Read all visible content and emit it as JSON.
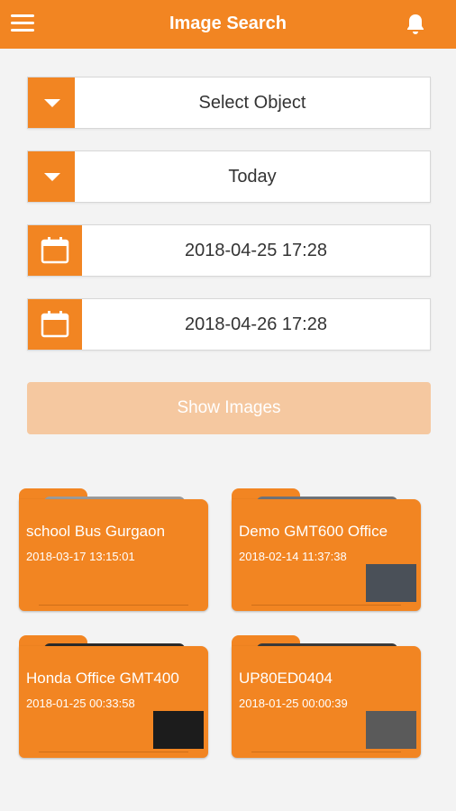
{
  "header": {
    "title": "Image Search",
    "menu_icon": "hamburger-menu-icon",
    "bell_icon": "bell-icon"
  },
  "filters": {
    "object": {
      "label": "Select Object",
      "icon": "chevron-down-icon"
    },
    "range": {
      "label": "Today",
      "icon": "chevron-down-icon"
    },
    "start": {
      "value": "2018-04-25 17:28",
      "icon": "calendar-icon"
    },
    "end": {
      "value": "2018-04-26 17:28",
      "icon": "calendar-icon"
    }
  },
  "show_button": "Show Images",
  "colors": {
    "accent": "#f28522",
    "button_disabled": "#f5c8a0",
    "background": "#f3f3f3"
  },
  "folders": [
    {
      "name": "school Bus Gurgaon",
      "date": "2018-03-17 13:15:01",
      "has_thumb": false
    },
    {
      "name": "Demo GMT600 Office",
      "date": "2018-02-14 11:37:38",
      "has_thumb": true
    },
    {
      "name": "Honda Office GMT400",
      "date": "2018-01-25 00:33:58",
      "has_thumb": true
    },
    {
      "name": "UP80ED0404",
      "date": "2018-01-25 00:00:39",
      "has_thumb": true
    }
  ]
}
